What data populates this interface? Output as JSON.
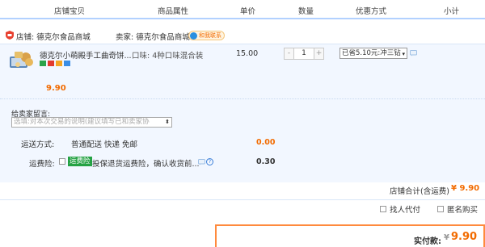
{
  "header": {
    "col_item": "店铺宝贝",
    "col_attr": "商品属性",
    "col_price": "单价",
    "col_qty": "数量",
    "col_discount": "优惠方式",
    "col_subtotal": "小计"
  },
  "shop": {
    "shop_label": "店铺: 德克尔食品商城",
    "seller_label": "卖家: 德克尔食品商城",
    "contact_badge": "和我联系"
  },
  "item": {
    "title": "德克尔小萌殿手工曲奇饼...",
    "attribute": "口味: 4种口味混合装",
    "unit_price": "15.00",
    "quantity": "1",
    "qty_minus": "-",
    "qty_plus": "+",
    "discount_selected": "已省5.10元:冲三钻",
    "subtotal": "9.90",
    "badge_colors": [
      "#2aa34a",
      "#e23b2e",
      "#f5a623",
      "#3a8ee6"
    ]
  },
  "message": {
    "label": "给卖家留言:",
    "placeholder": "选填:对本次交易的说明(建议填写已和卖家协"
  },
  "shipping": {
    "label": "运送方式:",
    "value": "普通配送 快递 免邮",
    "price": "0.00"
  },
  "insurance": {
    "label": "运费险:",
    "tag": "运费险",
    "text": "投保退货运费险，确认收货前...",
    "help": "?",
    "price": "0.30"
  },
  "shop_total": {
    "label": "店铺合计(含运费)",
    "value": "¥ 9.90"
  },
  "options": {
    "proxy_pay": "找人代付",
    "anonymous": "匿名购买"
  },
  "payment": {
    "label": "实付款:",
    "currency": "¥",
    "value": "9.90"
  },
  "colors": {
    "accent_orange": "#f26b00",
    "header_border": "#b2d1ff",
    "item_bg": "#f2f7ff",
    "pay_border": "#ff8a3d",
    "insurance_tag": "#25a244"
  }
}
